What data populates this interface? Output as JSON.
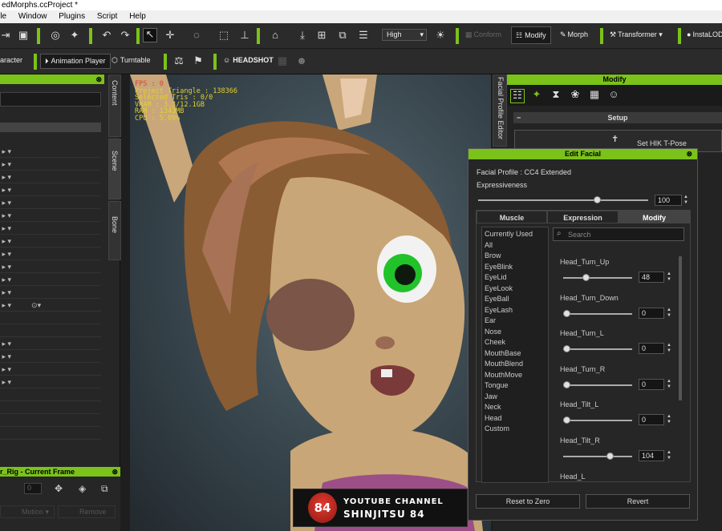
{
  "window": {
    "title": "edMorphs.ccProject *"
  },
  "menu": [
    "File",
    "Window",
    "Plugins",
    "Script",
    "Help"
  ],
  "toolbar1": {
    "quality_select": "High",
    "conform_label": "Conform",
    "modify_label": "Modify",
    "morph_label": "Morph",
    "transformer_label": "Transformer",
    "instalod_label": "InstaLOD"
  },
  "toolbar2": {
    "character_label": "aracter",
    "animation_player_label": "Animation Player",
    "turntable_label": "Turntable",
    "headshot_label": "HEADSHOT"
  },
  "side_tabs": [
    "Content",
    "Scene",
    "Bone"
  ],
  "bottom_panel": {
    "title": "r_Rig - Current Frame",
    "value": "0",
    "motion_label": "Motion",
    "remove_label": "Remove"
  },
  "viewport": {
    "stats": [
      "FPS : 0",
      "Project Triangle : 138366",
      "Selected Tris : 0/0",
      "VRAM : 3.3/12.1GB",
      "RAM : 1343MB",
      "CPU : 5.09%"
    ]
  },
  "right_panel": {
    "vertical_tab": "Facial Profile Editor",
    "header": "Modify",
    "setup_label": "Setup",
    "hik_button": "Set HIK T-Pose"
  },
  "edit_facial": {
    "title": "Edit Facial",
    "facial_profile": "Facial Profile : CC4 Extended",
    "expressiveness_label": "Expressiveness",
    "expressiveness_value": "100",
    "expressiveness_fraction": 0.7,
    "tabs": [
      "Muscle",
      "Expression",
      "Modify"
    ],
    "active_tab": 2,
    "categories": [
      "Currently Used",
      "All",
      "Brow",
      "EyeBlink",
      "EyeLid",
      "EyeLook",
      "EyeBall",
      "EyeLash",
      "Ear",
      "Nose",
      "Cheek",
      "MouthBase",
      "MouthBlend",
      "MouthMove",
      "Tongue",
      "Jaw",
      "Neck",
      "Head",
      "Custom"
    ],
    "search_placeholder": "Search",
    "morphs": [
      {
        "label": "Head_Turn_Up",
        "value": "48",
        "fraction": 0.32
      },
      {
        "label": "Head_Turn_Down",
        "value": "0",
        "fraction": 0.05
      },
      {
        "label": "Head_Turn_L",
        "value": "0",
        "fraction": 0.05
      },
      {
        "label": "Head_Turn_R",
        "value": "0",
        "fraction": 0.05
      },
      {
        "label": "Head_Tilt_L",
        "value": "0",
        "fraction": 0.05
      },
      {
        "label": "Head_Tilt_R",
        "value": "104",
        "fraction": 0.68
      },
      {
        "label": "Head_L",
        "value": "",
        "fraction": 0
      }
    ],
    "reset_label": "Reset to Zero",
    "revert_label": "Revert"
  },
  "banner": {
    "line1": "YOUTUBE CHANNEL",
    "line2": "SHINJITSU 84",
    "logo_text": "84"
  },
  "colors": {
    "accent": "#7bc21a",
    "stats": "#e4d032",
    "eye": "#22c22a"
  }
}
